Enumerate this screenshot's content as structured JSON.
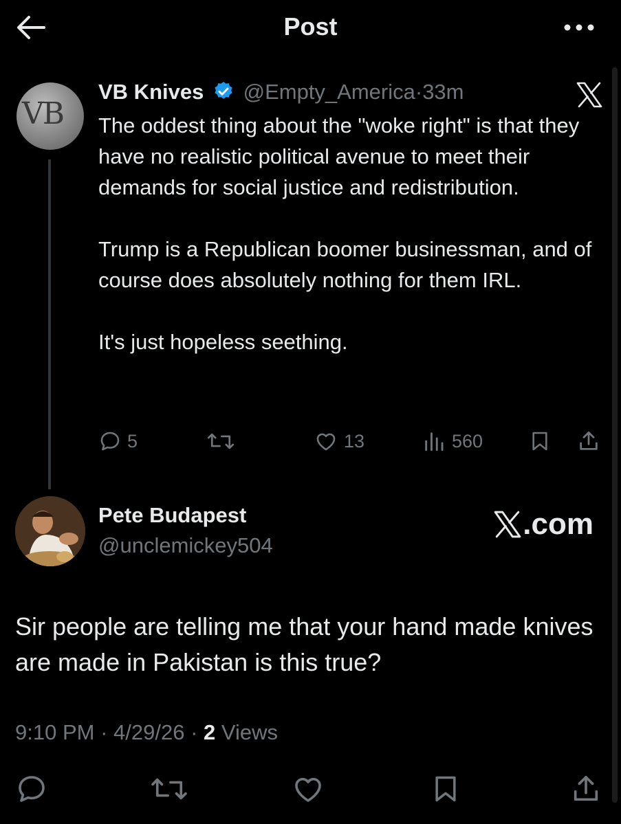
{
  "header": {
    "title": "Post"
  },
  "tweet": {
    "avatar_text": "VB",
    "name": "VB Knives",
    "handle": "@Empty_America",
    "time": "33m",
    "separator": "·",
    "paragraphs": [
      "The oddest thing about the \"woke right\" is that they have no realistic political avenue to meet their demands for social justice and redistribution.",
      "Trump is a Republican boomer businessman, and of course does absolutely nothing for them IRL.",
      "It's just hopeless seething."
    ],
    "replies": "5",
    "likes": "13",
    "views": "560"
  },
  "reply": {
    "name": "Pete Budapest",
    "handle": "@unclemickey504",
    "brand_suffix": ".com",
    "text": "Sir people are telling me that your hand made knives are made in Pakistan is this true?",
    "time": "9:10 PM",
    "date": "4/29/26",
    "views_count": "2",
    "views_label": "Views",
    "separator": "·"
  },
  "colors": {
    "background": "#000000",
    "text": "#e7e9ea",
    "muted": "#71767b",
    "verified": "#1d9bf0"
  },
  "icons": [
    "back-arrow-icon",
    "more-icon",
    "x-logo-icon",
    "verified-badge-icon",
    "reply-icon",
    "retweet-icon",
    "like-icon",
    "views-icon",
    "bookmark-icon",
    "share-icon"
  ]
}
